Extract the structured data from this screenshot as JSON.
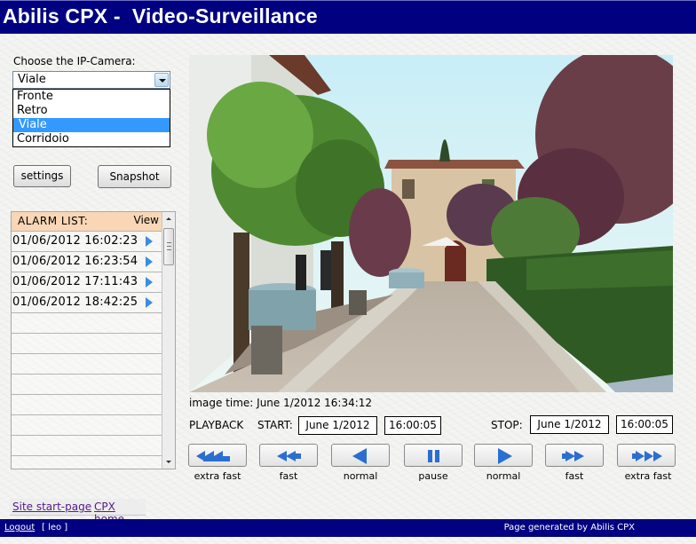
{
  "header": {
    "title": "Abilis CPX -  Video-Surveillance"
  },
  "camera": {
    "label": "Choose the IP-Camera:",
    "selected": "Viale",
    "options": [
      "Fronte",
      "Retro",
      "Viale",
      "Corridoio"
    ],
    "selected_index": 2
  },
  "buttons": {
    "settings": "settings",
    "snapshot": "Snapshot"
  },
  "alarm_list": {
    "title": "ALARM LIST:",
    "view_label": "View",
    "entries": [
      "01/06/2012 16:02:23",
      "01/06/2012 16:23:54",
      "01/06/2012 17:11:43",
      "01/06/2012 18:42:25"
    ],
    "empty_rows": 8
  },
  "video": {
    "image_time_label": "image time:",
    "image_time": "June 1/2012  16:34:12",
    "image_time_full": "image time: June 1/2012  16:34:12"
  },
  "playback": {
    "label": "PLAYBACK",
    "start_label": "START:",
    "start_date": "June 1/2012",
    "start_time": "16:00:05",
    "stop_label": "STOP:",
    "stop_date": "June 1/2012",
    "stop_time": "16:00:05",
    "controls": [
      {
        "id": "rewind-extra-fast",
        "caption": "extra fast",
        "icon": "triple-left-arrow-icon"
      },
      {
        "id": "rewind-fast",
        "caption": "fast",
        "icon": "double-left-arrow-icon"
      },
      {
        "id": "rewind-normal",
        "caption": "normal",
        "icon": "left-arrow-icon"
      },
      {
        "id": "pause",
        "caption": "pause",
        "icon": "pause-icon"
      },
      {
        "id": "play-normal",
        "caption": "normal",
        "icon": "right-arrow-icon"
      },
      {
        "id": "forward-fast",
        "caption": "fast",
        "icon": "double-right-arrow-icon"
      },
      {
        "id": "forward-extra-fast",
        "caption": "extra fast",
        "icon": "triple-right-arrow-icon"
      }
    ],
    "icon_color": "#2a6fd0"
  },
  "links": {
    "site_start": "Site start-page",
    "cpx_home": "CPX home"
  },
  "footer": {
    "logout": "Logout",
    "user": "[ leo ]",
    "generated": "Page generated by Abilis CPX"
  },
  "colors": {
    "brand_bar": "#000080",
    "alarm_header": "#f9d6b6",
    "selection": "#3399ff"
  }
}
